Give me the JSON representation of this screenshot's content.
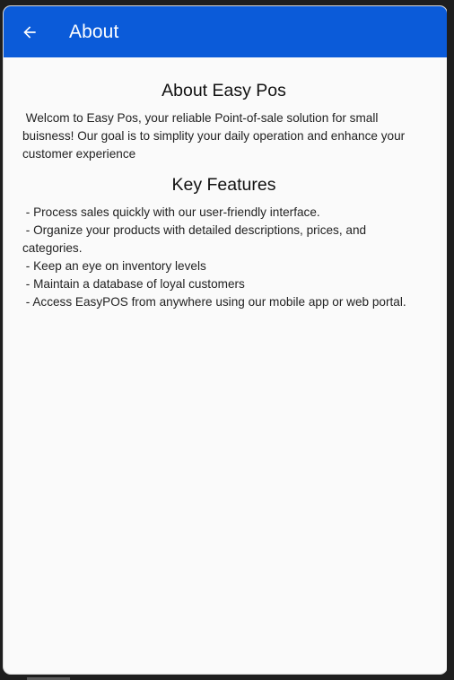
{
  "appbar": {
    "title": "About",
    "back_icon": "arrow-left-icon",
    "color": "#0b5bd9"
  },
  "about": {
    "heading": "About Easy Pos",
    "text": " Welcom to Easy Pos, your reliable Point-of-sale solution for small buisness! Our goal is to simplity your daily operation and enhance your customer experience"
  },
  "features": {
    "heading": "Key Features",
    "items": [
      " - Process sales quickly with our user-friendly interface.",
      " - Organize your products with detailed descriptions, prices, and categories.",
      " - Keep an eye on inventory levels",
      " - Maintain a database of loyal customers",
      " - Access EasyPOS from anywhere using our mobile app or web portal."
    ]
  }
}
